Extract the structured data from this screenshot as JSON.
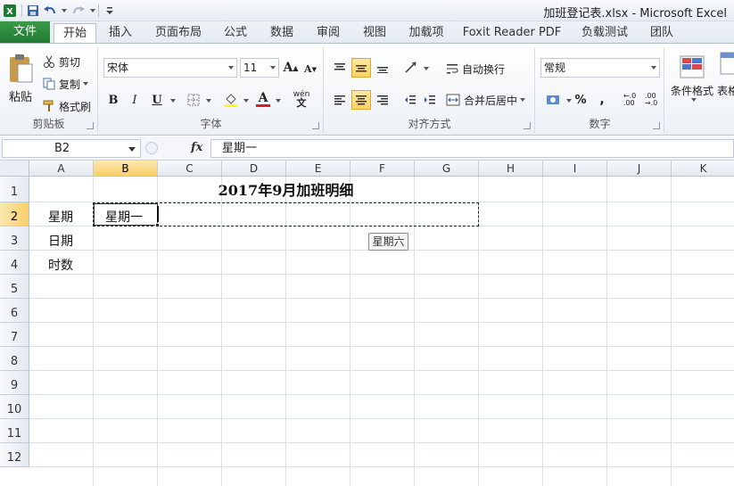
{
  "window": {
    "title": "加班登记表.xlsx  -  Microsoft Excel"
  },
  "tabs": [
    {
      "label": "文件"
    },
    {
      "label": "开始"
    },
    {
      "label": "插入"
    },
    {
      "label": "页面布局"
    },
    {
      "label": "公式"
    },
    {
      "label": "数据"
    },
    {
      "label": "审阅"
    },
    {
      "label": "视图"
    },
    {
      "label": "加载项"
    },
    {
      "label": "Foxit Reader PDF"
    },
    {
      "label": "负载测试"
    },
    {
      "label": "团队"
    }
  ],
  "active_tab": "开始",
  "ribbon": {
    "clipboard": {
      "paste": "粘贴",
      "cut": "剪切",
      "copy": "复制",
      "format_painter": "格式刷",
      "label": "剪贴板"
    },
    "font": {
      "name": "宋体",
      "size": "11",
      "bold": "B",
      "italic": "I",
      "underline": "U",
      "grow": "A",
      "shrink": "A",
      "font_color": "A",
      "phonetic": "wén",
      "label": "字体"
    },
    "alignment": {
      "wrap": "自动换行",
      "merge": "合并后居中",
      "label": "对齐方式"
    },
    "number": {
      "format": "常规",
      "percent": "%",
      "comma": ",",
      "label": "数字"
    },
    "styles": {
      "conditional": "条件格式",
      "table": "表格"
    }
  },
  "formula_bar": {
    "name_box": "B2",
    "fx": "fx",
    "value": "星期一"
  },
  "columns": [
    "A",
    "B",
    "C",
    "D",
    "E",
    "F",
    "G",
    "H",
    "I",
    "J",
    "K"
  ],
  "rows": [
    "1",
    "2",
    "3",
    "4",
    "5",
    "6",
    "7",
    "8",
    "9",
    "10",
    "11",
    "12"
  ],
  "sheet": {
    "title": "2017年9月加班明细",
    "a2": "星期",
    "a3": "日期",
    "a4": "时数",
    "b2": "星期一",
    "autofill_tip": "星期六"
  },
  "colors": {
    "file_tab": "#2a8a3a",
    "selected": "#ffd35a",
    "grid_line": "#dadfe6"
  }
}
